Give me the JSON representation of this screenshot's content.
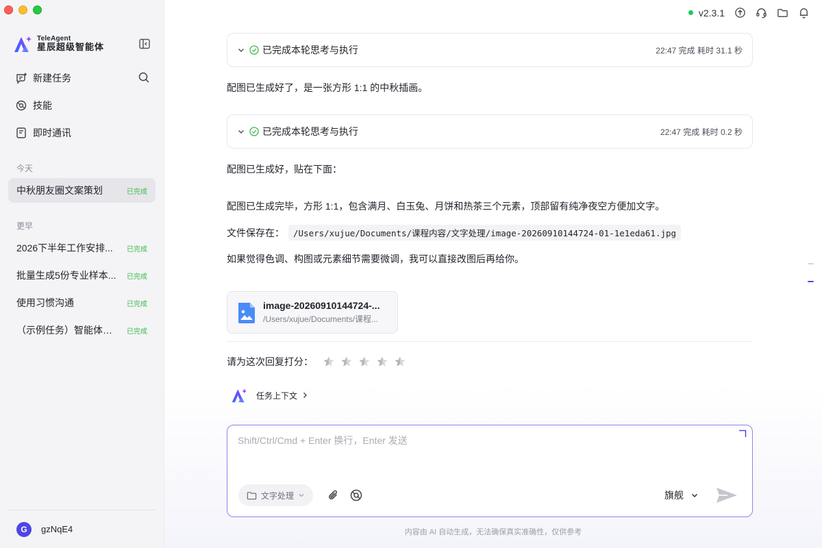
{
  "app": {
    "brand_en": "TeleAgent",
    "brand_cn": "星辰超级智能体",
    "version": "v2.3.1"
  },
  "sidebar": {
    "nav": [
      {
        "label": "新建任务",
        "icon": "new-task-icon"
      },
      {
        "label": "技能",
        "icon": "skills-icon"
      },
      {
        "label": "即时通讯",
        "icon": "im-icon"
      }
    ],
    "today_label": "今天",
    "earlier_label": "更早",
    "today_tasks": [
      {
        "title": "中秋朋友圈文案策划",
        "status": "已完成",
        "active": true
      }
    ],
    "earlier_tasks": [
      {
        "title": "2026下半年工作安排...",
        "status": "已完成"
      },
      {
        "title": "批量生成5份专业样本...",
        "status": "已完成"
      },
      {
        "title": "使用习惯沟通",
        "status": "已完成"
      },
      {
        "title": "（示例任务）智能体招...",
        "status": "已完成"
      }
    ],
    "user": {
      "avatar_letter": "G",
      "name": "gzNqE4"
    }
  },
  "conversation": {
    "step1": {
      "title": "已完成本轮思考与执行",
      "meta": "22:47 完成 耗时 31.1 秒"
    },
    "msg1": "配图已生成好了，是一张方形 1:1 的中秋插画。",
    "step2": {
      "title": "已完成本轮思考与执行",
      "meta": "22:47 完成 耗时 0.2 秒"
    },
    "msg2": "配图已生成好，贴在下面：",
    "msg3": "配图已生成完毕，方形 1:1，包含满月、白玉兔、月饼和热茶三个元素，顶部留有纯净夜空方便加文字。",
    "path_label": "文件保存在：",
    "path_value": "/Users/xujue/Documents/课程内容/文字处理/image-20260910144724-01-1e1eda61.jpg",
    "msg4": "如果觉得色调、构图或元素细节需要微调，我可以直接改图后再给你。",
    "file": {
      "name": "image-20260910144724-...",
      "path": "/Users/xujue/Documents/课程..."
    },
    "rating_label": "请为这次回复打分：",
    "rating_value": 0,
    "context_label": "任务上下文"
  },
  "composer": {
    "placeholder": "Shift/Ctrl/Cmd + Enter 换行，Enter 发送",
    "folder": "文字处理",
    "model": "旗舰"
  },
  "footer": {
    "disclaimer": "内容由 AI 自动生成，无法确保真实准确性，仅供参考"
  },
  "colors": {
    "accent": "#4f46e5",
    "success": "#3fb950",
    "online": "#22c55e",
    "sidebar_bg": "#f4f4f6",
    "composer_border": "#8a86e6"
  }
}
